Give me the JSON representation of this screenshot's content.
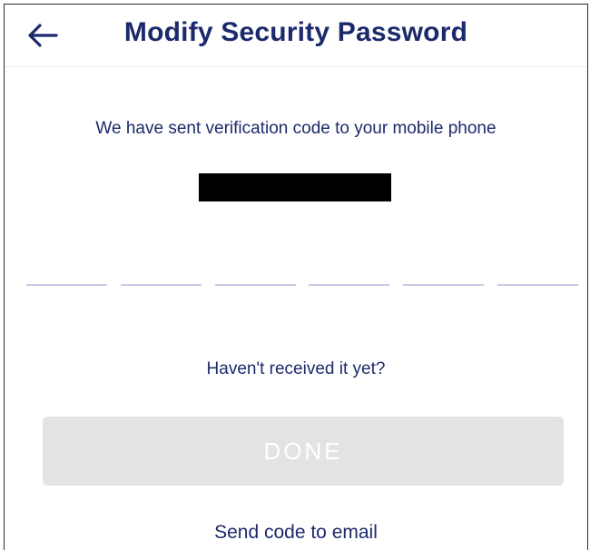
{
  "header": {
    "back_icon": "arrow-left-icon",
    "title": "Modify Security Password"
  },
  "main": {
    "message": "We have sent verification code to your mobile phone",
    "phone_number_redacted": true,
    "code_slots": 6,
    "resend_prompt": "Haven't received it yet?",
    "done_label": "DONE",
    "send_email_label": "Send code to email"
  },
  "colors": {
    "text_primary": "#1c2a6b",
    "button_disabled_bg": "#e3e3e3",
    "slot_underline": "#c9cce6"
  }
}
